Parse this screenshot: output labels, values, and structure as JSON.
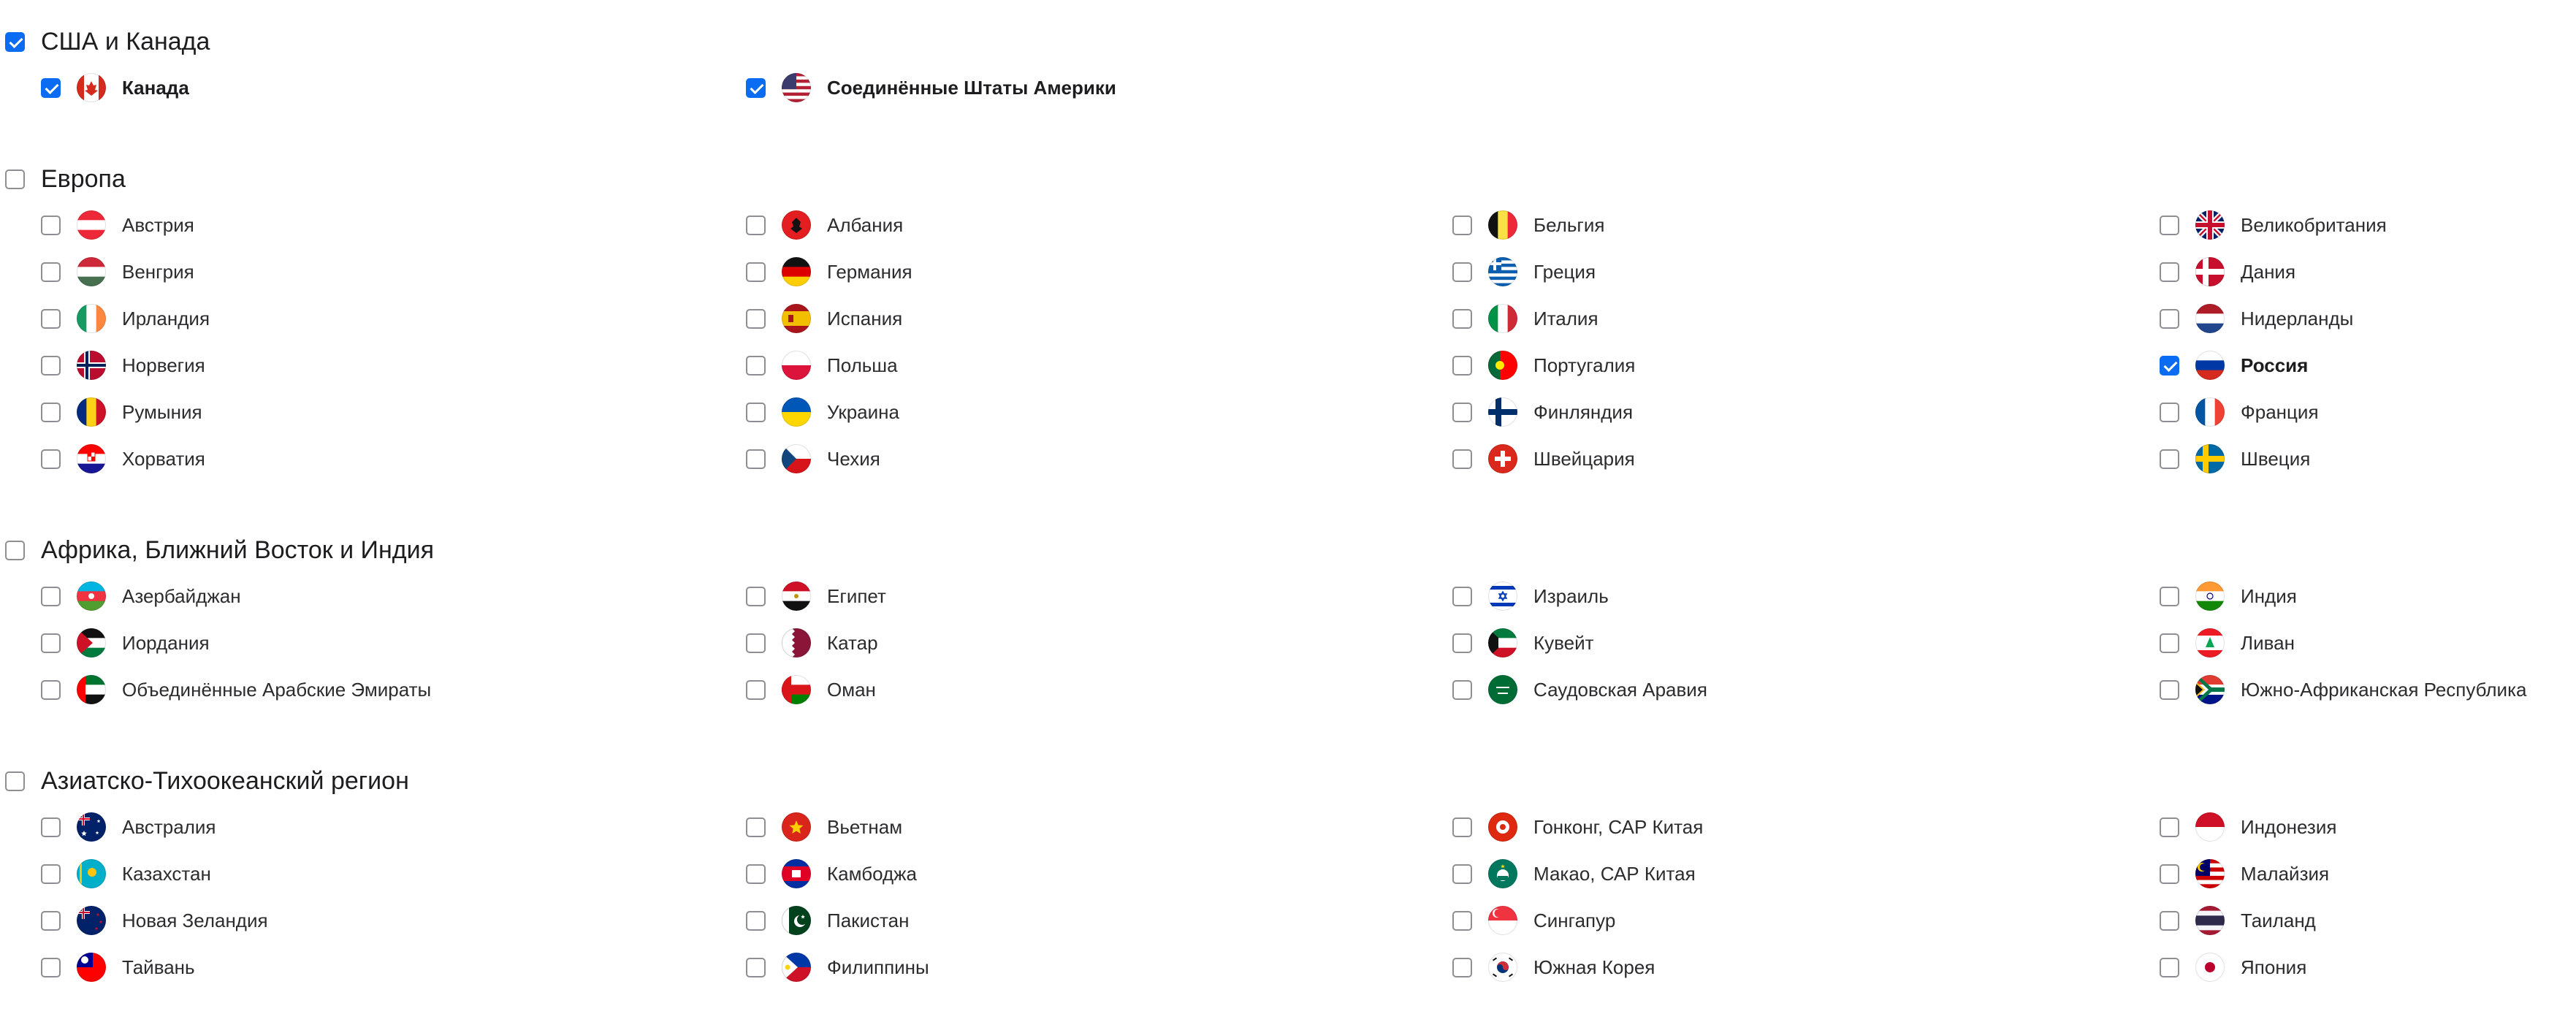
{
  "groups": [
    {
      "title": "США и Канада",
      "checked": true,
      "items": [
        {
          "label": "Канада",
          "checked": true,
          "flag": "canada-flag"
        },
        {
          "label": "Соединённые Штаты Америки",
          "checked": true,
          "flag": "usa-flag"
        }
      ]
    },
    {
      "title": "Европа",
      "checked": false,
      "items": [
        {
          "label": "Австрия",
          "checked": false,
          "flag": "austria-flag"
        },
        {
          "label": "Албания",
          "checked": false,
          "flag": "albania-flag"
        },
        {
          "label": "Бельгия",
          "checked": false,
          "flag": "belgium-flag"
        },
        {
          "label": "Великобритания",
          "checked": false,
          "flag": "uk-flag"
        },
        {
          "label": "Венгрия",
          "checked": false,
          "flag": "hungary-flag"
        },
        {
          "label": "Германия",
          "checked": false,
          "flag": "germany-flag"
        },
        {
          "label": "Греция",
          "checked": false,
          "flag": "greece-flag"
        },
        {
          "label": "Дания",
          "checked": false,
          "flag": "denmark-flag"
        },
        {
          "label": "Ирландия",
          "checked": false,
          "flag": "ireland-flag"
        },
        {
          "label": "Испания",
          "checked": false,
          "flag": "spain-flag"
        },
        {
          "label": "Италия",
          "checked": false,
          "flag": "italy-flag"
        },
        {
          "label": "Нидерланды",
          "checked": false,
          "flag": "netherlands-flag"
        },
        {
          "label": "Норвегия",
          "checked": false,
          "flag": "norway-flag"
        },
        {
          "label": "Польша",
          "checked": false,
          "flag": "poland-flag"
        },
        {
          "label": "Португалия",
          "checked": false,
          "flag": "portugal-flag"
        },
        {
          "label": "Россия",
          "checked": true,
          "flag": "russia-flag"
        },
        {
          "label": "Румыния",
          "checked": false,
          "flag": "romania-flag"
        },
        {
          "label": "Украина",
          "checked": false,
          "flag": "ukraine-flag"
        },
        {
          "label": "Финляндия",
          "checked": false,
          "flag": "finland-flag"
        },
        {
          "label": "Франция",
          "checked": false,
          "flag": "france-flag"
        },
        {
          "label": "Хорватия",
          "checked": false,
          "flag": "croatia-flag"
        },
        {
          "label": "Чехия",
          "checked": false,
          "flag": "czechia-flag"
        },
        {
          "label": "Швейцария",
          "checked": false,
          "flag": "switzerland-flag"
        },
        {
          "label": "Швеция",
          "checked": false,
          "flag": "sweden-flag"
        }
      ]
    },
    {
      "title": "Африка, Ближний Восток и Индия",
      "checked": false,
      "items": [
        {
          "label": "Азербайджан",
          "checked": false,
          "flag": "azerbaijan-flag"
        },
        {
          "label": "Египет",
          "checked": false,
          "flag": "egypt-flag"
        },
        {
          "label": "Израиль",
          "checked": false,
          "flag": "israel-flag"
        },
        {
          "label": "Индия",
          "checked": false,
          "flag": "india-flag"
        },
        {
          "label": "Иордания",
          "checked": false,
          "flag": "jordan-flag"
        },
        {
          "label": "Катар",
          "checked": false,
          "flag": "qatar-flag"
        },
        {
          "label": "Кувейт",
          "checked": false,
          "flag": "kuwait-flag"
        },
        {
          "label": "Ливан",
          "checked": false,
          "flag": "lebanon-flag"
        },
        {
          "label": "Объединённые Арабские Эмираты",
          "checked": false,
          "flag": "uae-flag"
        },
        {
          "label": "Оман",
          "checked": false,
          "flag": "oman-flag"
        },
        {
          "label": "Саудовская Аравия",
          "checked": false,
          "flag": "saudi-arabia-flag"
        },
        {
          "label": "Южно-Африканская Республика",
          "checked": false,
          "flag": "south-africa-flag"
        }
      ]
    },
    {
      "title": "Азиатско-Тихоокеанский регион",
      "checked": false,
      "items": [
        {
          "label": "Австралия",
          "checked": false,
          "flag": "australia-flag"
        },
        {
          "label": "Вьетнам",
          "checked": false,
          "flag": "vietnam-flag"
        },
        {
          "label": "Гонконг, САР Китая",
          "checked": false,
          "flag": "hong-kong-flag"
        },
        {
          "label": "Индонезия",
          "checked": false,
          "flag": "indonesia-flag"
        },
        {
          "label": "Казахстан",
          "checked": false,
          "flag": "kazakhstan-flag"
        },
        {
          "label": "Камбоджа",
          "checked": false,
          "flag": "cambodia-flag"
        },
        {
          "label": "Макао, САР Китая",
          "checked": false,
          "flag": "macao-flag"
        },
        {
          "label": "Малайзия",
          "checked": false,
          "flag": "malaysia-flag"
        },
        {
          "label": "Новая Зеландия",
          "checked": false,
          "flag": "new-zealand-flag"
        },
        {
          "label": "Пакистан",
          "checked": false,
          "flag": "pakistan-flag"
        },
        {
          "label": "Сингапур",
          "checked": false,
          "flag": "singapore-flag"
        },
        {
          "label": "Таиланд",
          "checked": false,
          "flag": "thailand-flag"
        },
        {
          "label": "Тайвань",
          "checked": false,
          "flag": "taiwan-flag"
        },
        {
          "label": "Филиппины",
          "checked": false,
          "flag": "philippines-flag"
        },
        {
          "label": "Южная Корея",
          "checked": false,
          "flag": "south-korea-flag"
        },
        {
          "label": "Япония",
          "checked": false,
          "flag": "japan-flag"
        }
      ]
    }
  ],
  "colors": {
    "accent": "#0a6cf2",
    "border": "#8e8e93",
    "text": "#1d1d1f"
  }
}
